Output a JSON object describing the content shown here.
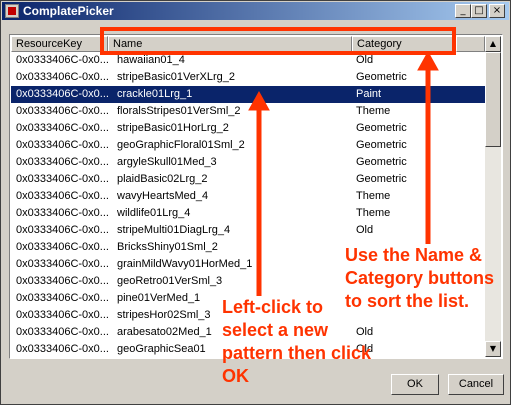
{
  "window": {
    "title": "ComplatePicker"
  },
  "titlebar_buttons": [
    "_",
    "□",
    "×"
  ],
  "list": {
    "columns": [
      "ResourceKey",
      "Name",
      "Category"
    ],
    "rows": [
      [
        "0x0333406C-0x0...",
        "hawaiian01_4",
        "Old"
      ],
      [
        "0x0333406C-0x0...",
        "stripeBasic01VerXLrg_2",
        "Geometric"
      ],
      [
        "0x0333406C-0x0...",
        "crackle01Lrg_1",
        "Paint"
      ],
      [
        "0x0333406C-0x0...",
        "floralsStripes01VerSml_2",
        "Theme"
      ],
      [
        "0x0333406C-0x0...",
        "stripeBasic01HorLrg_2",
        "Geometric"
      ],
      [
        "0x0333406C-0x0...",
        "geoGraphicFloral01Sml_2",
        "Geometric"
      ],
      [
        "0x0333406C-0x0...",
        "argyleSkull01Med_3",
        "Geometric"
      ],
      [
        "0x0333406C-0x0...",
        "plaidBasic02Lrg_2",
        "Geometric"
      ],
      [
        "0x0333406C-0x0...",
        "wavyHeartsMed_4",
        "Theme"
      ],
      [
        "0x0333406C-0x0...",
        "wildlife01Lrg_4",
        "Theme"
      ],
      [
        "0x0333406C-0x0...",
        "stripeMulti01DiagLrg_4",
        "Old"
      ],
      [
        "0x0333406C-0x0...",
        "BricksShiny01Sml_2",
        ""
      ],
      [
        "0x0333406C-0x0...",
        "grainMildWavy01HorMed_1",
        ""
      ],
      [
        "0x0333406C-0x0...",
        "geoRetro01VerSml_3",
        ""
      ],
      [
        "0x0333406C-0x0...",
        "pine01VerMed_1",
        ""
      ],
      [
        "0x0333406C-0x0...",
        "stripesHor02Sml_3",
        ""
      ],
      [
        "0x0333406C-0x0...",
        "arabesato02Med_1",
        "Old"
      ],
      [
        "0x0333406C-0x0...",
        "geoGraphicSea01",
        "Old"
      ]
    ],
    "selected_index": 2
  },
  "buttons": {
    "ok": "OK",
    "cancel": "Cancel"
  },
  "scroll_arrows": {
    "up": "▲",
    "down": "▼"
  },
  "annotations": {
    "left_click": "Left-click to select a new pattern then click OK",
    "sort": "Use the Name & Category buttons to sort the list."
  },
  "colors": {
    "annotation": "#ff3300",
    "selection": "#0a246a",
    "titlebar": "#0a246a",
    "face": "#d4d0c8"
  }
}
